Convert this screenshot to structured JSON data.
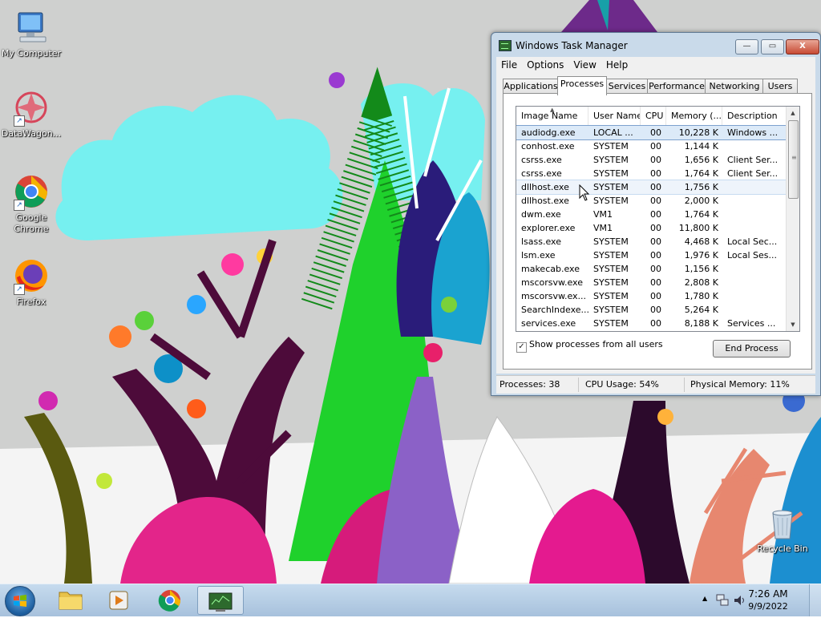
{
  "desktop": {
    "icons": [
      {
        "label": "My Computer",
        "icon": "computer-icon"
      },
      {
        "label": "DataWagon...",
        "icon": "datawagon-icon"
      },
      {
        "label": "Google Chrome",
        "icon": "chrome-icon"
      },
      {
        "label": "Firefox",
        "icon": "firefox-icon"
      },
      {
        "label": "Recycle Bin",
        "icon": "recycle-bin-icon"
      }
    ],
    "shortcut_glyph": "↗"
  },
  "task_manager": {
    "title": "Windows Task Manager",
    "window_buttons": {
      "minimize": "—",
      "maximize": "▭",
      "close": "X"
    },
    "menu": [
      "File",
      "Options",
      "View",
      "Help"
    ],
    "tabs": [
      "Applications",
      "Processes",
      "Services",
      "Performance",
      "Networking",
      "Users"
    ],
    "active_tab": "Processes",
    "columns": [
      "Image Name",
      "User Name",
      "CPU",
      "Memory (...",
      "Description"
    ],
    "sort_glyph": "▲",
    "processes": [
      {
        "name": "audiodg.exe",
        "user": "LOCAL ...",
        "cpu": "00",
        "mem": "10,228 K",
        "desc": "Windows ..."
      },
      {
        "name": "conhost.exe",
        "user": "SYSTEM",
        "cpu": "00",
        "mem": "1,144 K",
        "desc": ""
      },
      {
        "name": "csrss.exe",
        "user": "SYSTEM",
        "cpu": "00",
        "mem": "1,656 K",
        "desc": "Client Ser..."
      },
      {
        "name": "csrss.exe",
        "user": "SYSTEM",
        "cpu": "00",
        "mem": "1,764 K",
        "desc": "Client Ser..."
      },
      {
        "name": "dllhost.exe",
        "user": "SYSTEM",
        "cpu": "00",
        "mem": "1,756 K",
        "desc": ""
      },
      {
        "name": "dllhost.exe",
        "user": "SYSTEM",
        "cpu": "00",
        "mem": "2,000 K",
        "desc": ""
      },
      {
        "name": "dwm.exe",
        "user": "VM1",
        "cpu": "00",
        "mem": "1,764 K",
        "desc": ""
      },
      {
        "name": "explorer.exe",
        "user": "VM1",
        "cpu": "00",
        "mem": "11,800 K",
        "desc": ""
      },
      {
        "name": "lsass.exe",
        "user": "SYSTEM",
        "cpu": "00",
        "mem": "4,468 K",
        "desc": "Local Sec..."
      },
      {
        "name": "lsm.exe",
        "user": "SYSTEM",
        "cpu": "00",
        "mem": "1,976 K",
        "desc": "Local Ses..."
      },
      {
        "name": "makecab.exe",
        "user": "SYSTEM",
        "cpu": "00",
        "mem": "1,156 K",
        "desc": ""
      },
      {
        "name": "mscorsvw.exe",
        "user": "SYSTEM",
        "cpu": "00",
        "mem": "2,808 K",
        "desc": ""
      },
      {
        "name": "mscorsvw.ex...",
        "user": "SYSTEM",
        "cpu": "00",
        "mem": "1,780 K",
        "desc": ""
      },
      {
        "name": "SearchIndexe...",
        "user": "SYSTEM",
        "cpu": "00",
        "mem": "5,264 K",
        "desc": ""
      },
      {
        "name": "services.exe",
        "user": "SYSTEM",
        "cpu": "00",
        "mem": "8,188 K",
        "desc": "Services ..."
      }
    ],
    "selected_row": 0,
    "hovered_row": 4,
    "show_all_users": {
      "label": "Show processes from all users",
      "checked": true,
      "check_glyph": "✓"
    },
    "end_process_label": "End Process",
    "status": {
      "processes": "Processes: 38",
      "cpu": "CPU Usage: 54%",
      "memory": "Physical Memory: 11%"
    },
    "scroll_glyphs": {
      "up": "▲",
      "down": "▼",
      "grip": "≡"
    }
  },
  "taskbar": {
    "pinned": [
      {
        "name": "explorer",
        "icon": "folder-icon"
      },
      {
        "name": "media-player",
        "icon": "media-player-icon"
      },
      {
        "name": "chrome",
        "icon": "chrome-icon"
      },
      {
        "name": "task-manager",
        "icon": "task-manager-icon",
        "active": true
      }
    ],
    "tray": {
      "expand_glyph": "▲",
      "network_icon": "network-icon",
      "volume_icon": "volume-icon"
    },
    "clock": {
      "time": "7:26 AM",
      "date": "9/9/2022"
    }
  },
  "colors": {
    "wallpaper_bg": "#cfd0cf",
    "selection": "#dceaf8",
    "window_frame": "#c9daea",
    "taskbar": "#b3cbe3"
  }
}
